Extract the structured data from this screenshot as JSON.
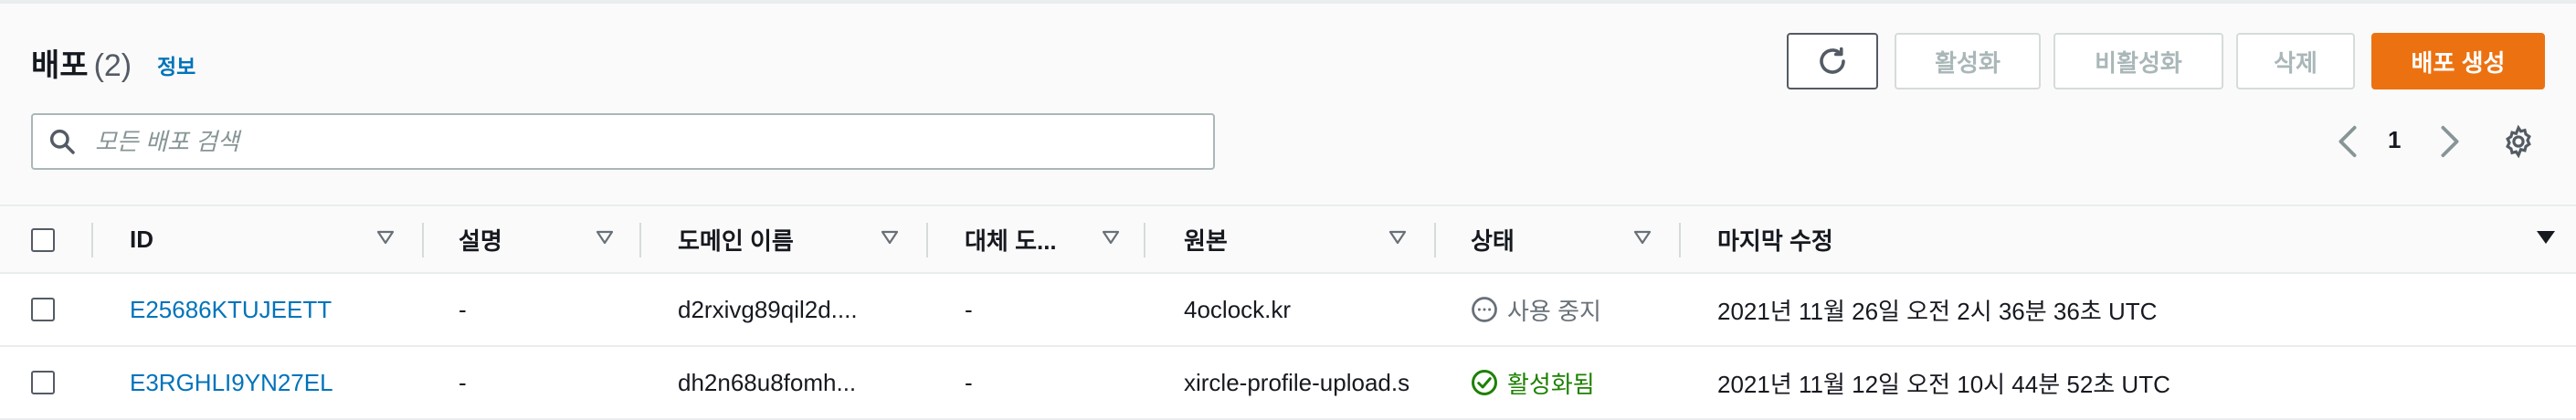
{
  "header": {
    "title": "배포",
    "count": "(2)",
    "info_link": "정보"
  },
  "actions": {
    "activate": "활성화",
    "deactivate": "비활성화",
    "delete": "삭제",
    "create": "배포 생성"
  },
  "search": {
    "placeholder": "모든 배포 검색"
  },
  "pagination": {
    "current_page": "1"
  },
  "table": {
    "columns": {
      "id": "ID",
      "description": "설명",
      "domain": "도메인 이름",
      "alt_domain": "대체 도...",
      "origin": "원본",
      "status": "상태",
      "last_modified": "마지막 수정"
    },
    "rows": [
      {
        "id": "E25686KTUJEETT",
        "description": "-",
        "domain": "d2rxivg89qil2d....",
        "alt_domain": "-",
        "origin": "4oclock.kr",
        "status": "사용 중지",
        "last_modified": "2021년 11월 26일 오전 2시 36분 36초 UTC"
      },
      {
        "id": "E3RGHLI9YN27EL",
        "description": "-",
        "domain": "dh2n68u8fomh...",
        "alt_domain": "-",
        "origin": "xircle-profile-upload.s",
        "status": "활성화됨",
        "last_modified": "2021년 11월 12일 오전 10시 44분 52초 UTC"
      }
    ]
  },
  "colors": {
    "primary": "#ec7211",
    "link": "#0073bb",
    "success": "#1d8102",
    "muted": "#687078",
    "disabled": "#aab7b8"
  },
  "icons": [
    "refresh-icon",
    "search-icon",
    "chevron-left-icon",
    "chevron-right-icon",
    "gear-icon",
    "sort-icon",
    "sort-desc-icon",
    "status-stopped-icon",
    "status-success-icon"
  ]
}
